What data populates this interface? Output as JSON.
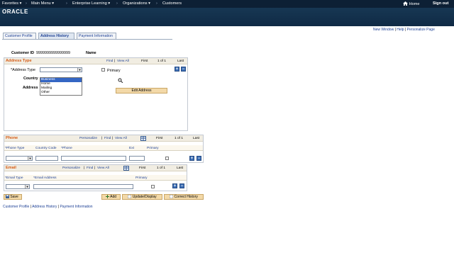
{
  "topnav": {
    "favorites": "Favorites",
    "main_menu": "Main Menu",
    "enterprise_learning": "Enterprise Learning",
    "organizations": "Organizations",
    "customers": "Customers",
    "home": "Home",
    "sign_out": "Sign out",
    "sep": "›",
    "caret": "▾"
  },
  "brand": {
    "logo": "ORACLE"
  },
  "utility_links": {
    "new_window": "New Window",
    "help": "Help",
    "personalize_page": "Personalize Page",
    "bar": "|"
  },
  "tabs": [
    {
      "label": "Customer Profile"
    },
    {
      "label": "Address History"
    },
    {
      "label": "Payment Information"
    }
  ],
  "customer": {
    "id_label": "Customer ID",
    "id_value": "9999999999999999",
    "name_label": "Name"
  },
  "address_type_section": {
    "title": "Address Type",
    "find": "Find",
    "view_all": "View All",
    "first": "First",
    "page": "1 of 1",
    "last": "Last",
    "address_type_label": "*Address Type",
    "primary_label": "Primary",
    "country_label": "Country",
    "address_label": "Address",
    "edit_address_button": "Edit Address",
    "dropdown_options": [
      "Business",
      "Home",
      "Mailing",
      "Other"
    ],
    "dropdown_highlighted": "Business"
  },
  "phone_section": {
    "title": "Phone",
    "personalize": "Personalize",
    "find": "Find",
    "view_all": "View All",
    "first": "First",
    "page": "1 of 1",
    "last": "Last",
    "columns": [
      "*Phone Type",
      "Country Code",
      "*Phone",
      "Ext",
      "Primary"
    ]
  },
  "email_section": {
    "title": "Email",
    "personalize": "Personalize",
    "find": "Find",
    "view_all": "View All",
    "first": "First",
    "page": "1 of 1",
    "last": "Last",
    "columns": [
      "*Email Type",
      "*Email Address",
      "Primary"
    ]
  },
  "toolbar": {
    "save": "Save",
    "add": "Add",
    "update_display": "Update/Display",
    "correct_history": "Correct History"
  },
  "footer_links": {
    "customer_profile": "Customer Profile",
    "address_history": "Address History",
    "payment_information": "Payment Information",
    "bar": "|"
  },
  "colors": {
    "nav_bg": "#0d2035",
    "section_title": "#d55a14",
    "button": "#f3d9a8",
    "link": "#1c3f94"
  }
}
